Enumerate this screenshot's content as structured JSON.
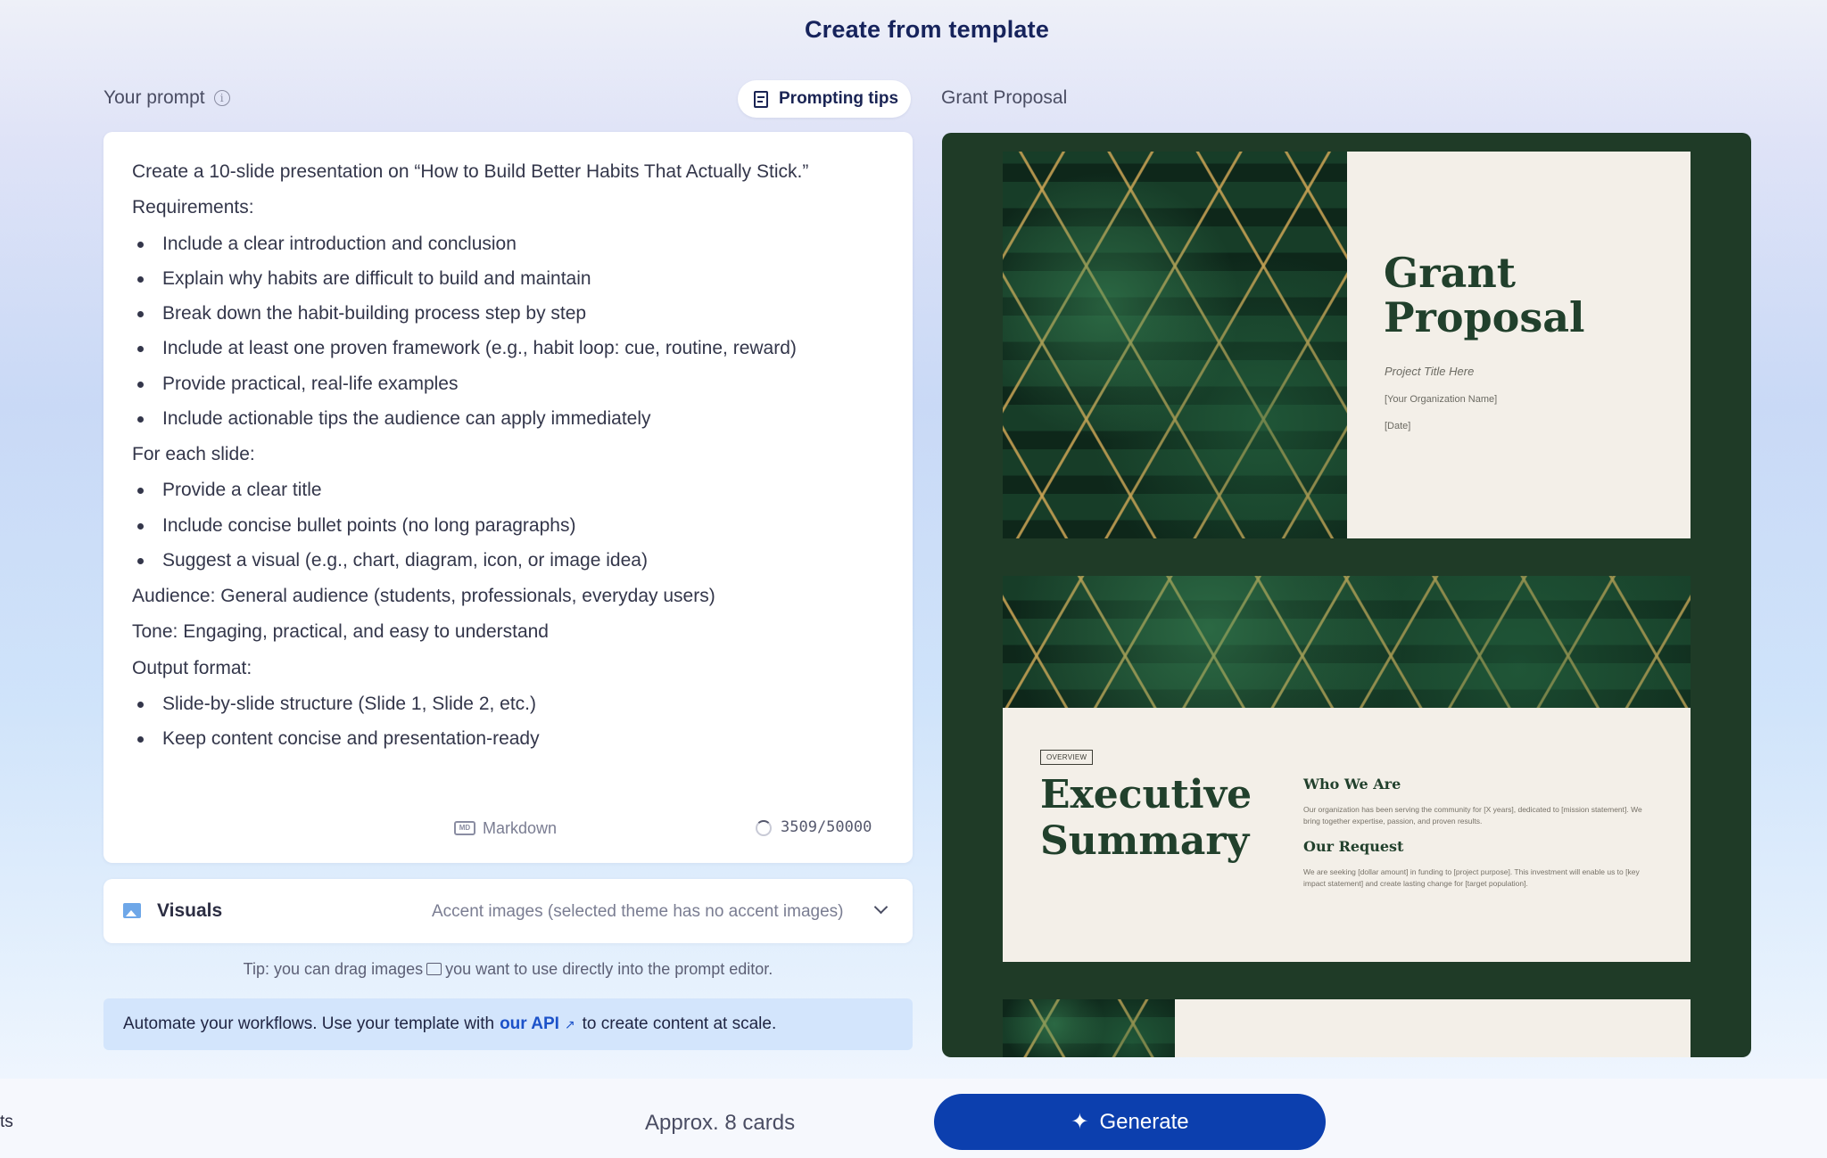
{
  "header": {
    "title": "Create from template"
  },
  "prompt": {
    "label": "Your prompt",
    "info_icon": "i",
    "tips_button": "Prompting tips",
    "intro": "Create a 10-slide presentation on “How to Build Better Habits That Actually Stick.”",
    "requirements_heading": "Requirements:",
    "requirements": [
      "Include a clear introduction and conclusion",
      "Explain why habits are difficult to build and maintain",
      "Break down the habit-building process step by step",
      "Include at least one proven framework (e.g., habit loop: cue, routine, reward)",
      "Provide practical, real-life examples",
      "Include actionable tips the audience can apply immediately"
    ],
    "each_slide_heading": "For each slide:",
    "each_slide": [
      "Provide a clear title",
      "Include concise bullet points (no long paragraphs)",
      "Suggest a visual (e.g., chart, diagram, icon, or image idea)"
    ],
    "audience": "Audience: General audience (students, professionals, everyday users)",
    "tone": "Tone: Engaging, practical, and easy to understand",
    "output_heading": "Output format:",
    "output": [
      "Slide-by-slide structure (Slide 1, Slide 2, etc.)",
      "Keep content concise and presentation-ready"
    ],
    "markdown_icon_text": "MD",
    "markdown_label": "Markdown",
    "char_count": "3509/50000"
  },
  "visuals": {
    "label": "Visuals",
    "value": "Accent images (selected theme has no accent images)"
  },
  "tip": {
    "before": "Tip: you can drag images",
    "after": "you want to use directly into the prompt editor."
  },
  "api": {
    "before": "Automate your workflows. Use your template with",
    "link": "our API",
    "after": "to create content at scale."
  },
  "preview": {
    "label": "Grant Proposal",
    "slide1": {
      "title": "Grant Proposal",
      "subtitle": "Project Title Here",
      "org": "[Your Organization Name]",
      "date": "[Date]"
    },
    "slide2": {
      "tag": "OVERVIEW",
      "title": "Executive Summary",
      "who_heading": "Who We Are",
      "who_body": "Our organization has been serving the community for [X years], dedicated to [mission statement]. We bring together expertise, passion, and proven results.",
      "request_heading": "Our Request",
      "request_body": "We are seeking [dollar amount] in funding to [project purpose]. This investment will enable us to [key impact statement] and create lasting change for [target population]."
    }
  },
  "footer": {
    "edge_text": "ts",
    "approx": "Approx. 8 cards",
    "generate": "Generate"
  },
  "colors": {
    "accent": "#0c3fae",
    "link": "#1c52c9",
    "preview_bg": "#1f3b27",
    "slide_bg": "#f3efe8",
    "slide_title": "#21402c"
  }
}
